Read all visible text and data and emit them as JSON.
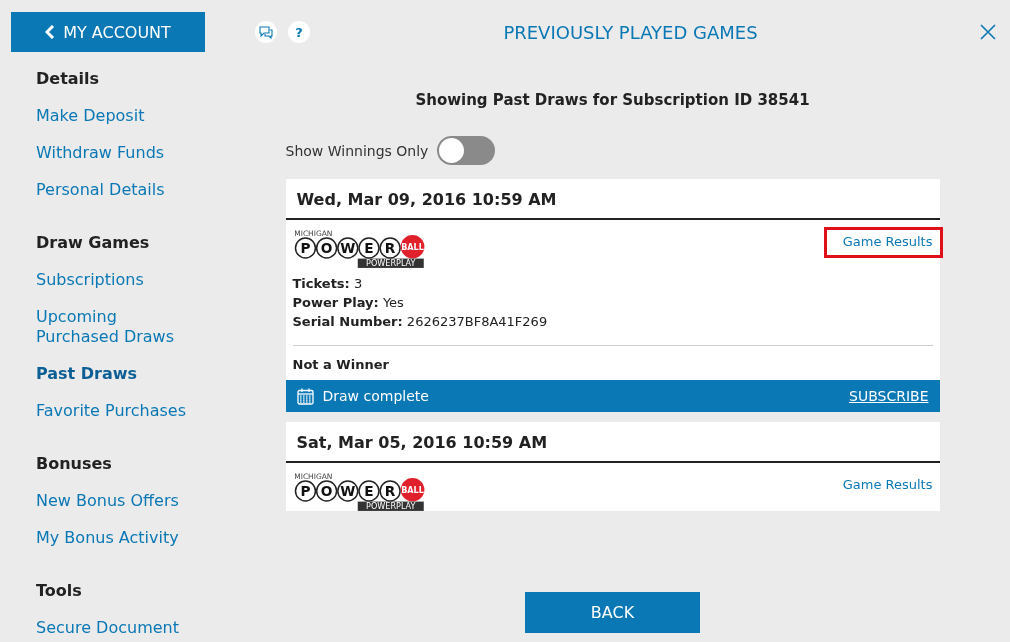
{
  "sidebar": {
    "back_button": {
      "label": "MY ACCOUNT"
    },
    "sections": [
      {
        "heading": "Details",
        "items": [
          {
            "label": "Make Deposit",
            "selected": false
          },
          {
            "label": "Withdraw Funds",
            "selected": false
          },
          {
            "label": "Personal Details",
            "selected": false
          }
        ]
      },
      {
        "heading": "Draw Games",
        "items": [
          {
            "label": "Subscriptions",
            "selected": false
          },
          {
            "label": "Upcoming Purchased Draws",
            "selected": false
          },
          {
            "label": "Past Draws",
            "selected": true
          },
          {
            "label": "Favorite Purchases",
            "selected": false
          }
        ]
      },
      {
        "heading": "Bonuses",
        "items": [
          {
            "label": "New Bonus Offers",
            "selected": false
          },
          {
            "label": "My Bonus Activity",
            "selected": false
          }
        ]
      },
      {
        "heading": "Tools",
        "items": [
          {
            "label": "Secure Document",
            "selected": false
          }
        ]
      }
    ]
  },
  "header": {
    "title": "PREVIOUSLY PLAYED GAMES",
    "help_label": "?"
  },
  "subtitle": "Showing Past Draws for Subscription ID 38541",
  "filter": {
    "label": "Show Winnings Only",
    "on": false
  },
  "draws": [
    {
      "date": "Wed, Mar 09, 2016 10:59 AM",
      "logo": {
        "top": "MICHIGAN",
        "letters": [
          "P",
          "O",
          "W",
          "E",
          "R"
        ],
        "ball": "BALL",
        "sub": "POWERPLAY"
      },
      "results_link": "Game Results",
      "highlighted": true,
      "details": [
        {
          "label": "Tickets:",
          "value": "3"
        },
        {
          "label": "Power Play:",
          "value": "Yes"
        },
        {
          "label": "Serial Number:",
          "value": "2626237BF8A41F269"
        }
      ],
      "outcome": "Not a Winner",
      "status": "Draw complete",
      "action": "SUBSCRIBE"
    },
    {
      "date": "Sat, Mar 05, 2016 10:59 AM",
      "logo": {
        "top": "MICHIGAN",
        "letters": [
          "P",
          "O",
          "W",
          "E",
          "R"
        ],
        "ball": "BALL",
        "sub": "POWERPLAY"
      },
      "results_link": "Game Results",
      "highlighted": false
    }
  ],
  "back_button": {
    "label": "BACK"
  }
}
